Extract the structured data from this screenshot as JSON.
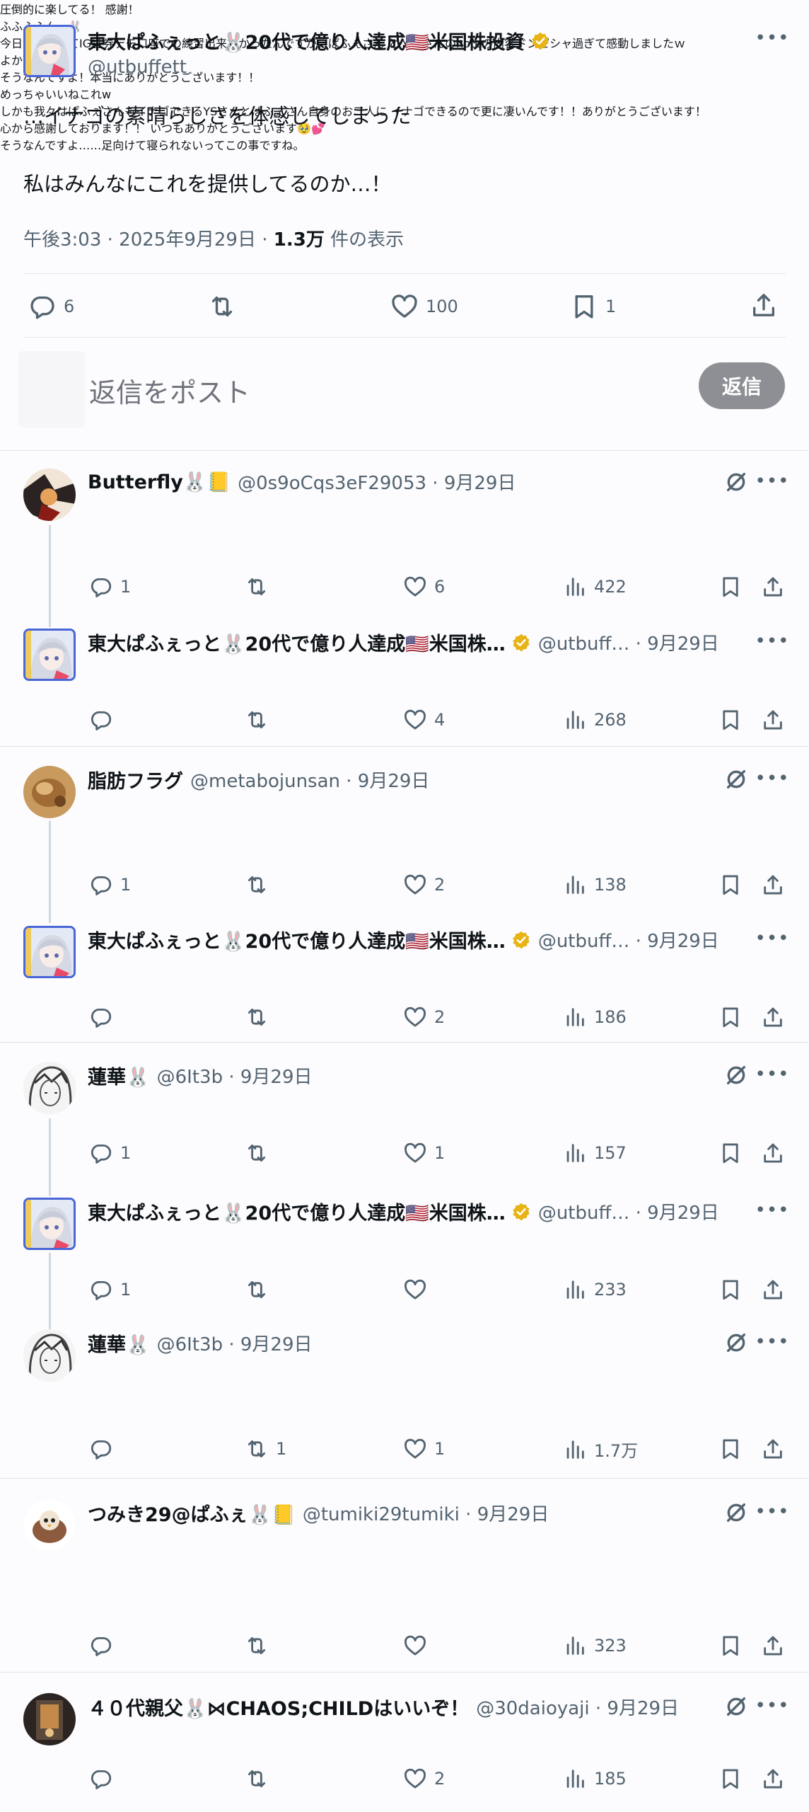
{
  "main_post": {
    "author_name": "東大ぱふぇっと🐰20代で億り人達成🇺🇸米国株投資",
    "author_handle": "@utbuffett",
    "text_line1": "…イナゴの素晴らしさを体感してしまった",
    "text_line2": "私はみんなにこれを提供してるのか…！",
    "time": "午後3:03 · 2025年9月29日 · ",
    "views_count": "1.3万",
    "views_label": " 件の表示",
    "replies": "6",
    "likes": "100",
    "bookmarks": "1"
  },
  "composer": {
    "placeholder": "返信をポスト",
    "button": "返信"
  },
  "replies": [
    {
      "name": "Butterfly🐰📒",
      "handle": "@0s9oCqs3eF29053 · 9月29日",
      "text": "圧倒的に楽してる！\n感謝！",
      "replies": "1",
      "retweets": "",
      "likes": "6",
      "views": "422"
    },
    {
      "name": "東大ぱふぇっと🐰20代で億り人達成🇺🇸米国株…",
      "handle": "@utbuff… · 9月29日",
      "text": "ふふふふんっ🐰",
      "replies": "",
      "retweets": "",
      "likes": "4",
      "views": "268"
    },
    {
      "name": "脂肪フラグ",
      "handle": "@metabojunsan · 9月29日",
      "text": "今日激務過ぎてIG証券デモ口座での練習出来なかったんですが、ぱふぇさん\nとＹＳさんのnoteの内容ドンピシャ過ぎて感動しましたｗ",
      "replies": "1",
      "retweets": "",
      "likes": "2",
      "views": "138"
    },
    {
      "name": "東大ぱふぇっと🐰20代で億り人達成🇺🇸米国株…",
      "handle": "@utbuff… · 9月29日",
      "text": "よかった！！",
      "replies": "",
      "retweets": "",
      "likes": "2",
      "views": "186"
    },
    {
      "name": "蓮華🐰",
      "handle": "@6It3b · 9月29日",
      "text": "そうなんですよ！本当にありがとうございます！！",
      "replies": "1",
      "retweets": "",
      "likes": "1",
      "views": "157"
    },
    {
      "name": "東大ぱふぇっと🐰20代で億り人達成🇺🇸米国株…",
      "handle": "@utbuff… · 9月29日",
      "text": "めっちゃいいねこれw",
      "replies": "1",
      "retweets": "",
      "likes": "",
      "views": "233"
    },
    {
      "name": "蓮華🐰",
      "handle": "@6It3b · 9月29日",
      "text": "しかも我々はぱふぇさんもイナゴできるYSさんとぱふぇさん自身のお二人に\nイナゴできるので更に凄いんです！！ありがとうございます！",
      "replies": "",
      "retweets": "1",
      "likes": "1",
      "views": "1.7万"
    },
    {
      "name": "つみき29@ぱふぇ🐰📒",
      "handle": "@tumiki29tumiki · 9月29日",
      "text": "心から感謝しております！！\n\nいつもありがとうございます🥹💕",
      "replies": "",
      "retweets": "",
      "likes": "",
      "views": "323"
    },
    {
      "name": "４０代親父🐰⋈CHAOS;CHILDはいいぞ！",
      "handle": "@30daioyaji · 9月29日",
      "text": "そうなんですよ……足向けて寝られないってこの事ですね。",
      "replies": "",
      "retweets": "",
      "likes": "2",
      "views": "185"
    }
  ],
  "colors": {
    "text": "#0f1419",
    "secondary": "#536471",
    "verified": "#e8b314",
    "reply_button": "#8e8f94"
  },
  "icons": [
    "reply-icon",
    "retweet-icon",
    "like-icon",
    "views-icon",
    "bookmark-icon",
    "share-icon",
    "more-icon",
    "verified-icon",
    "grok-icon"
  ]
}
